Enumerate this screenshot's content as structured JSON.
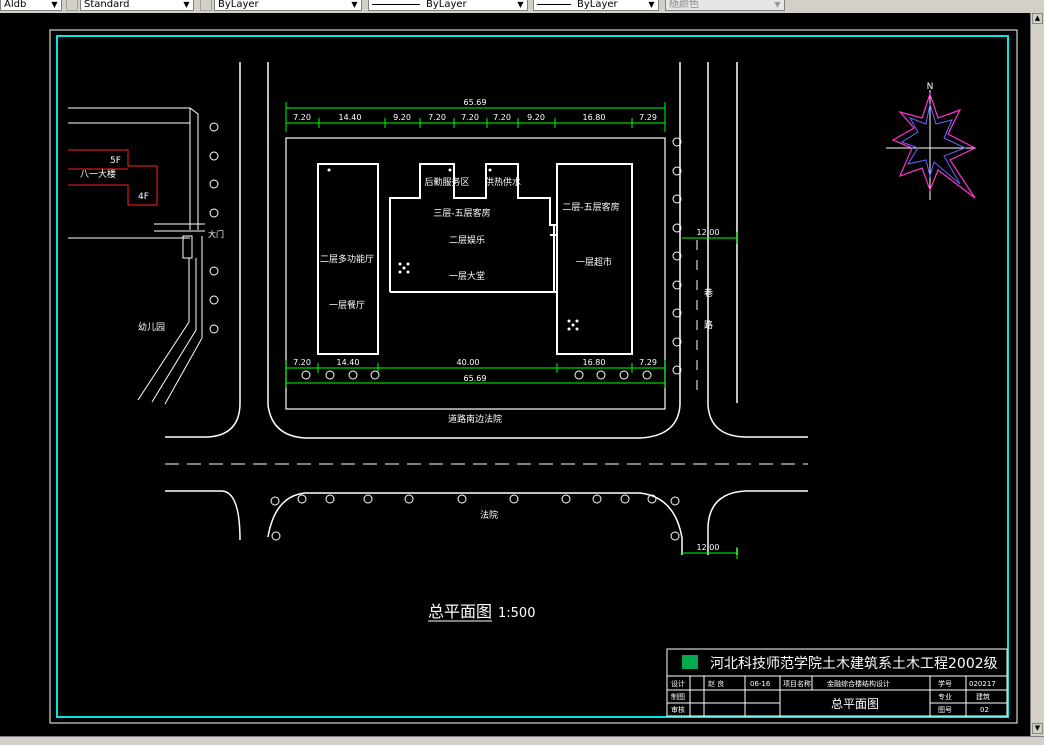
{
  "toolbar": {
    "textstyle": "Aldb",
    "dimstyle": "Standard",
    "layer": "ByLayer",
    "linetype": "ByLayer",
    "lineweight": "ByLayer",
    "plotstyle": "随颜色"
  },
  "drawing": {
    "top_dims": [
      "65.69",
      "7.20",
      "14.40",
      "9.20",
      "7.20",
      "7.20",
      "7.20",
      "9.20",
      "16.80",
      "7.29"
    ],
    "bottom_dims": [
      "7.20",
      "14.40",
      "40.00",
      "16.80",
      "7.29",
      "65.69"
    ],
    "road_width_top": "12.00",
    "road_width_bottom": "12.00",
    "labels": {
      "back_service": "后勤服务区",
      "boiler": "供热供水",
      "guest_3_5": "三层-五层客房",
      "second_floor_entertain": "二层娱乐",
      "first_floor_hall": "一层大堂",
      "left_second": "二层多功能厅",
      "left_first": "一层餐厅",
      "right_second": "二层-五层客房",
      "right_first": "一层超市",
      "north": "N",
      "bldg_81": "八一大楼",
      "floor_5f": "5F",
      "floor_4f": "4F",
      "gate": "大门",
      "kindergarten": "幼儿园",
      "road_right": "巷路",
      "street_top": "道路南边法院",
      "court": "法院",
      "plan_title": "总平面图",
      "scale": "1:500"
    }
  },
  "title_block": {
    "school": "河北科技师范学院土木建筑系土木工程2002级",
    "row1": [
      "设计",
      "赵 良",
      "06-16",
      "项目名称",
      "金融综合楼结构设计",
      "学号",
      "020217"
    ],
    "row2": [
      "制图",
      "总平面图",
      "专业",
      "建筑"
    ],
    "row3": [
      "审核",
      "图号",
      "02"
    ]
  },
  "colors": {
    "background": "#000000",
    "frame": "#00e5e5",
    "line": "#ffffff",
    "dimension": "#00ff00",
    "red": "#ff2020",
    "compass_pink": "#ff33cc"
  }
}
